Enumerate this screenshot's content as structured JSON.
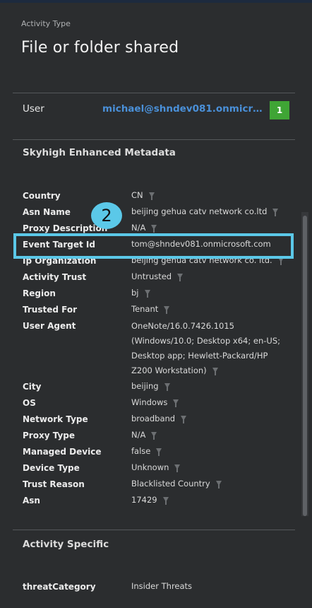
{
  "header": {
    "activity_type_label": "Activity Type",
    "activity_type_value": "File or folder shared"
  },
  "user": {
    "label": "User",
    "value": "michael@shndev081.onmicrosof...",
    "badge": "1"
  },
  "sections": {
    "skyhigh": "Skyhigh Enhanced Metadata",
    "activity_specific": "Activity Specific"
  },
  "fields": {
    "country": {
      "label": "Country",
      "value": "CN"
    },
    "asn_name": {
      "label": "Asn Name",
      "value": "beijing gehua catv network co.ltd"
    },
    "proxy_description": {
      "label": "Proxy Description",
      "value": "N/A"
    },
    "event_target_id": {
      "label": "Event Target Id",
      "value": "tom@shndev081.onmicrosoft.com"
    },
    "ip_organization": {
      "label": "Ip Organization",
      "value": "beijing gehua catv network co. ltd."
    },
    "activity_trust": {
      "label": "Activity Trust",
      "value": "Untrusted"
    },
    "region": {
      "label": "Region",
      "value": "bj"
    },
    "trusted_for": {
      "label": "Trusted For",
      "value": "Tenant"
    },
    "user_agent": {
      "label": "User Agent",
      "value": "OneNote/16.0.7426.1015 (Windows/10.0; Desktop x64; en-US; Desktop app; Hewlett-Packard/HP Z200 Workstation)"
    },
    "city": {
      "label": "City",
      "value": "beijing"
    },
    "os": {
      "label": "OS",
      "value": "Windows"
    },
    "network_type": {
      "label": "Network Type",
      "value": "broadband"
    },
    "proxy_type": {
      "label": "Proxy Type",
      "value": "N/A"
    },
    "managed_device": {
      "label": "Managed Device",
      "value": "false"
    },
    "device_type": {
      "label": "Device Type",
      "value": "Unknown"
    },
    "trust_reason": {
      "label": "Trust Reason",
      "value": "Blacklisted Country"
    },
    "asn": {
      "label": "Asn",
      "value": "17429"
    },
    "threat_category": {
      "label": "threatCategory",
      "value": "Insider Threats"
    }
  },
  "callout": {
    "number": "2"
  },
  "icons": {
    "filter": "filter-icon"
  },
  "colors": {
    "background": "#2b2d2f",
    "link": "#4a90d9",
    "badge": "#3fa535",
    "highlight": "#5bc8e8"
  }
}
